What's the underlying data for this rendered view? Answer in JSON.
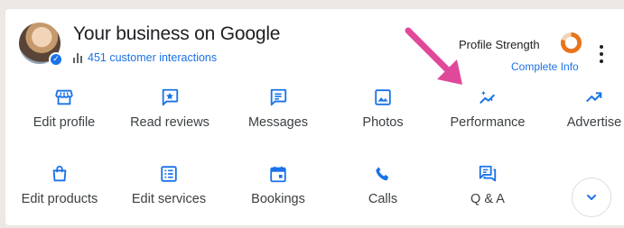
{
  "header": {
    "title": "Your business on Google",
    "interactions": "451 customer interactions",
    "profile_strength_label": "Profile Strength",
    "complete_info": "Complete Info",
    "profile_strength_fraction": 0.8
  },
  "actions_row1": [
    {
      "label": "Edit profile",
      "icon": "storefront-icon"
    },
    {
      "label": "Read reviews",
      "icon": "review-star-icon"
    },
    {
      "label": "Messages",
      "icon": "message-icon"
    },
    {
      "label": "Photos",
      "icon": "photo-icon"
    },
    {
      "label": "Performance",
      "icon": "performance-sparkle-icon"
    },
    {
      "label": "Advertise",
      "icon": "trending-up-icon"
    }
  ],
  "actions_row2": [
    {
      "label": "Edit products",
      "icon": "shopping-bag-icon"
    },
    {
      "label": "Edit services",
      "icon": "services-list-icon"
    },
    {
      "label": "Bookings",
      "icon": "calendar-icon"
    },
    {
      "label": "Calls",
      "icon": "phone-icon"
    },
    {
      "label": "Q & A",
      "icon": "qa-chat-icon"
    }
  ],
  "colors": {
    "accent": "#1a73e8",
    "annotation_arrow": "#e0489a",
    "strength_ring": "#e8741c"
  }
}
